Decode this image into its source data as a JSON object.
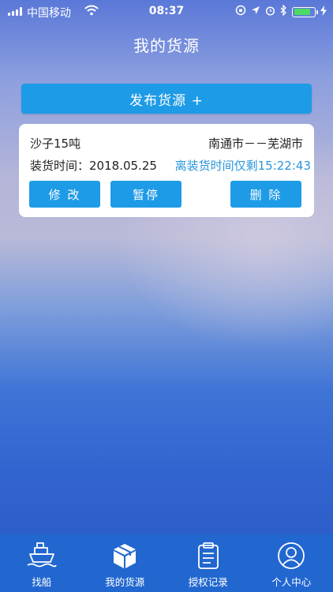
{
  "status_bar": {
    "carrier": "中国移动",
    "time": "08:37",
    "battery_level": 0.8
  },
  "header": {
    "title": "我的货源"
  },
  "publish_button": {
    "label": "发布货源 +"
  },
  "cargo_card": {
    "cargo": "沙子15吨",
    "route": "南通市－－芜湖市",
    "load_time_label": "装货时间：",
    "load_time": "2018.05.25",
    "countdown": "离装货时间仅剩15:22:43",
    "buttons": {
      "edit": "修 改",
      "pause": "暂停",
      "delete": "删 除"
    }
  },
  "tabs": [
    {
      "label": "找船",
      "icon": "ship-icon"
    },
    {
      "label": "我的货源",
      "icon": "box-icon"
    },
    {
      "label": "授权记录",
      "icon": "clipboard-icon"
    },
    {
      "label": "个人中心",
      "icon": "user-icon"
    }
  ],
  "colors": {
    "accent": "#1e9be6",
    "tab_bar": "#2267d0",
    "countdown": "#2a95dc"
  }
}
